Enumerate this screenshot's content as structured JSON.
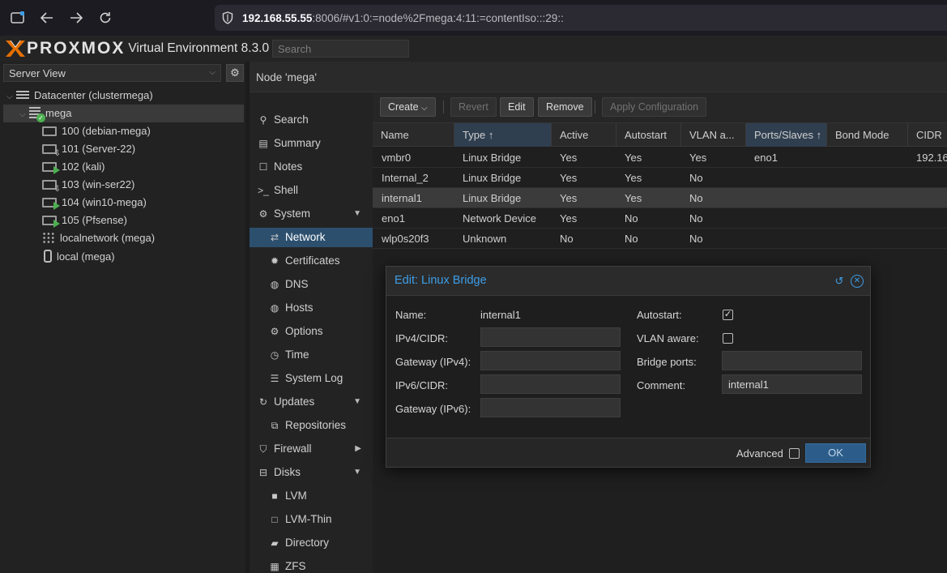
{
  "browser": {
    "url_host": "192.168.55.55",
    "url_rest": ":8006/#v1:0:=node%2Fmega:4:11:=contentIso:::29::"
  },
  "header": {
    "logo": "PROXMOX",
    "product": "Virtual Environment 8.3.0",
    "search_placeholder": "Search"
  },
  "tree": {
    "view": "Server View",
    "items": [
      {
        "label": "Datacenter (clustermega)"
      },
      {
        "label": "mega"
      },
      {
        "label": "100 (debian-mega)"
      },
      {
        "label": "101 (Server-22)"
      },
      {
        "label": "102 (kali)"
      },
      {
        "label": "103 (win-ser22)"
      },
      {
        "label": "104 (win10-mega)"
      },
      {
        "label": "105 (Pfsense)"
      },
      {
        "label": "localnetwork (mega)"
      },
      {
        "label": "local (mega)"
      }
    ]
  },
  "node_header": "Node 'mega'",
  "nav": {
    "items": [
      {
        "label": "Search"
      },
      {
        "label": "Summary"
      },
      {
        "label": "Notes"
      },
      {
        "label": "Shell"
      },
      {
        "label": "System"
      },
      {
        "label": "Network"
      },
      {
        "label": "Certificates"
      },
      {
        "label": "DNS"
      },
      {
        "label": "Hosts"
      },
      {
        "label": "Options"
      },
      {
        "label": "Time"
      },
      {
        "label": "System Log"
      },
      {
        "label": "Updates"
      },
      {
        "label": "Repositories"
      },
      {
        "label": "Firewall"
      },
      {
        "label": "Disks"
      },
      {
        "label": "LVM"
      },
      {
        "label": "LVM-Thin"
      },
      {
        "label": "Directory"
      },
      {
        "label": "ZFS"
      }
    ]
  },
  "toolbar": {
    "create": "Create",
    "revert": "Revert",
    "edit": "Edit",
    "remove": "Remove",
    "apply": "Apply Configuration"
  },
  "grid": {
    "columns": [
      "Name",
      "Type",
      "Active",
      "Autostart",
      "VLAN a...",
      "Ports/Slaves",
      "Bond Mode",
      "CIDR"
    ],
    "rows": [
      {
        "name": "vmbr0",
        "type": "Linux Bridge",
        "active": "Yes",
        "autostart": "Yes",
        "vlan": "Yes",
        "ports": "eno1",
        "bond": "",
        "cidr": "192.16"
      },
      {
        "name": "Internal_2",
        "type": "Linux Bridge",
        "active": "Yes",
        "autostart": "Yes",
        "vlan": "No",
        "ports": "",
        "bond": "",
        "cidr": ""
      },
      {
        "name": "internal1",
        "type": "Linux Bridge",
        "active": "Yes",
        "autostart": "Yes",
        "vlan": "No",
        "ports": "",
        "bond": "",
        "cidr": ""
      },
      {
        "name": "eno1",
        "type": "Network Device",
        "active": "Yes",
        "autostart": "No",
        "vlan": "No",
        "ports": "",
        "bond": "",
        "cidr": ""
      },
      {
        "name": "wlp0s20f3",
        "type": "Unknown",
        "active": "No",
        "autostart": "No",
        "vlan": "No",
        "ports": "",
        "bond": "",
        "cidr": ""
      }
    ]
  },
  "dialog": {
    "title": "Edit: Linux Bridge",
    "name_label": "Name:",
    "name_value": "internal1",
    "ipv4_label": "IPv4/CIDR:",
    "ipv4_value": "",
    "gw4_label": "Gateway (IPv4):",
    "gw4_value": "",
    "ipv6_label": "IPv6/CIDR:",
    "ipv6_value": "",
    "gw6_label": "Gateway (IPv6):",
    "gw6_value": "",
    "autostart_label": "Autostart:",
    "autostart_checked": true,
    "vlan_label": "VLAN aware:",
    "vlan_checked": false,
    "ports_label": "Bridge ports:",
    "ports_value": "",
    "comment_label": "Comment:",
    "comment_value": "internal1",
    "advanced_label": "Advanced",
    "ok_label": "OK"
  }
}
